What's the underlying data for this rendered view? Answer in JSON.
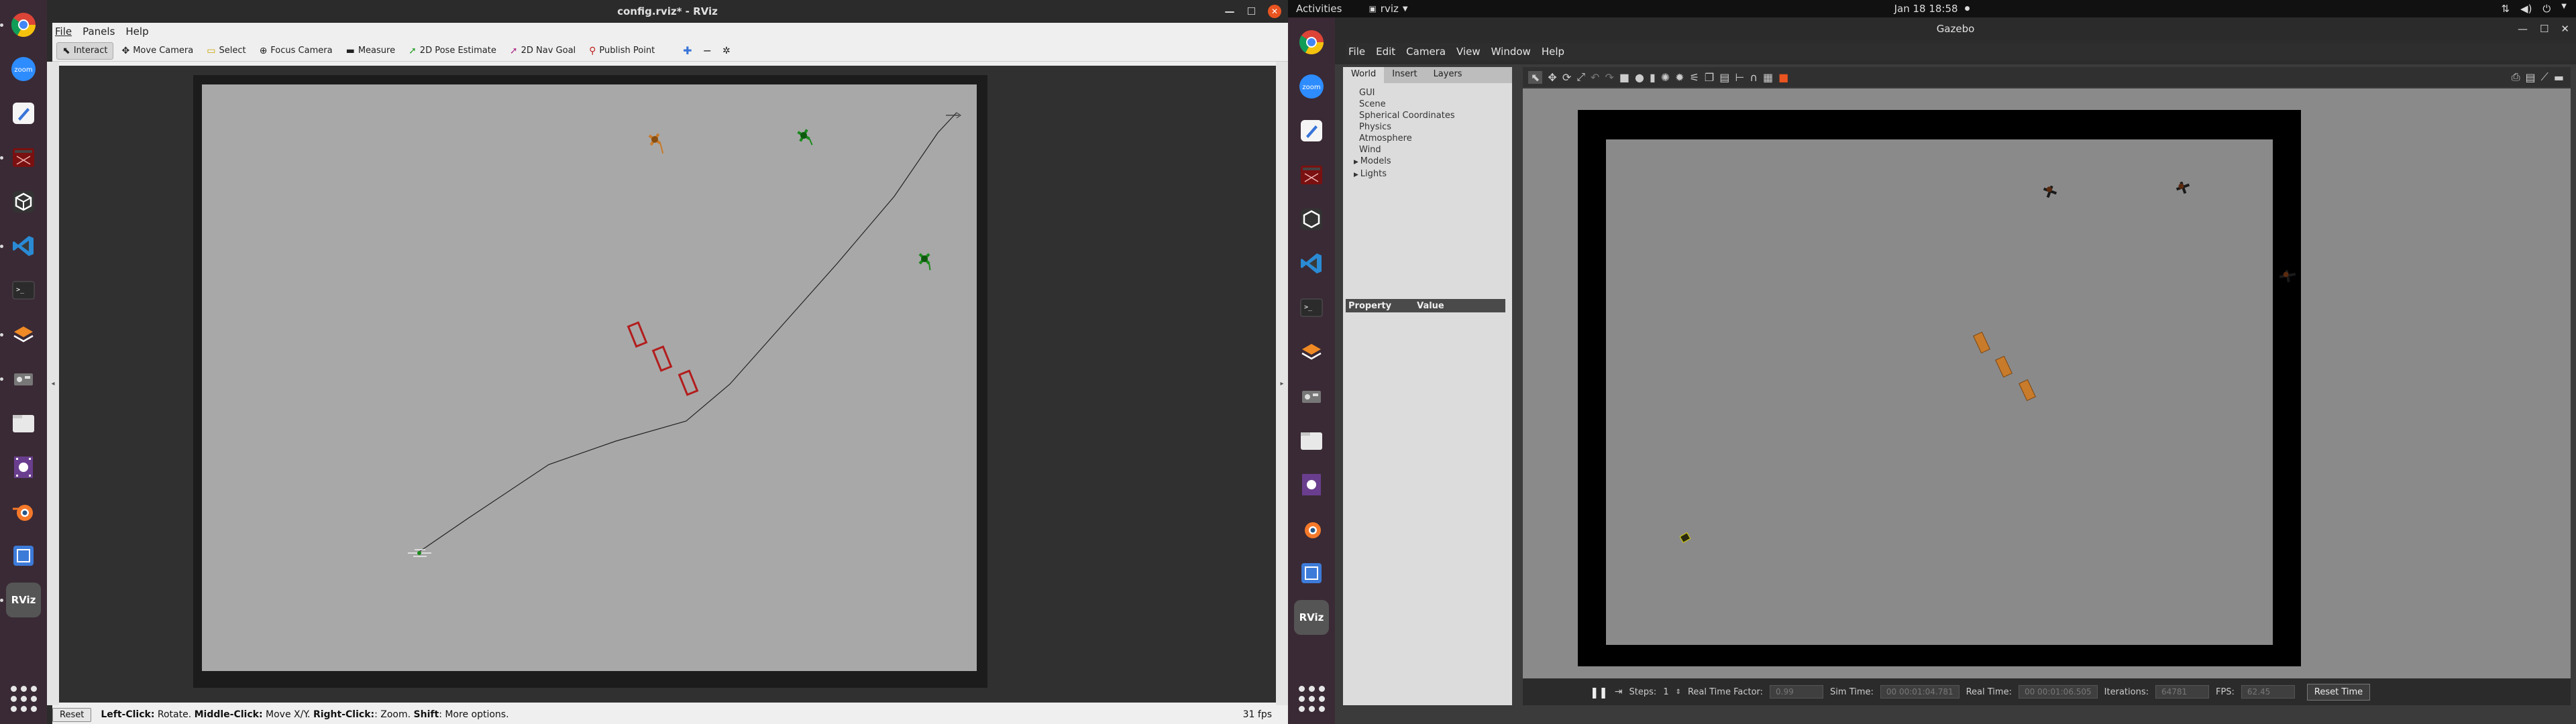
{
  "rviz": {
    "window_title": "config.rviz* - RViz",
    "menu": [
      "File",
      "Panels",
      "Help"
    ],
    "tools": [
      {
        "label": "Interact",
        "icon": "cursor-icon"
      },
      {
        "label": "Move Camera",
        "icon": "camera-icon"
      },
      {
        "label": "Select",
        "icon": "select-icon"
      },
      {
        "label": "Focus Camera",
        "icon": "focus-icon"
      },
      {
        "label": "Measure",
        "icon": "ruler-icon"
      },
      {
        "label": "2D Pose Estimate",
        "icon": "pose-arrow-icon"
      },
      {
        "label": "2D Nav Goal",
        "icon": "goal-arrow-icon"
      },
      {
        "label": "Publish Point",
        "icon": "pin-icon"
      }
    ],
    "status": {
      "reset_label": "Reset",
      "hint_parts": [
        {
          "bold": "Left-Click:",
          "text": " Rotate. "
        },
        {
          "bold": "Middle-Click:",
          "text": " Move X/Y. "
        },
        {
          "bold": "Right-Click:",
          "text": ": Zoom. "
        },
        {
          "bold": "Shift",
          "text": ": More options."
        }
      ],
      "fps": "31 fps"
    }
  },
  "topbar": {
    "activities": "Activities",
    "app_name": "rviz",
    "clock": "Jan 18  18:58"
  },
  "gazebo": {
    "window_title": "Gazebo",
    "menu": [
      "File",
      "Edit",
      "Camera",
      "View",
      "Window",
      "Help"
    ],
    "tabs": [
      "World",
      "Insert",
      "Layers"
    ],
    "tree": [
      "GUI",
      "Scene",
      "Spherical Coordinates",
      "Physics",
      "Atmosphere",
      "Wind",
      "Models",
      "Lights"
    ],
    "property_header": "Property",
    "value_header": "Value",
    "bottom": {
      "steps_label": "Steps:",
      "steps_value": "1",
      "rtf_label": "Real Time Factor:",
      "rtf_value": "0.99",
      "sim_time_label": "Sim Time:",
      "sim_time_value": "00 00:01:04.781",
      "real_time_label": "Real Time:",
      "real_time_value": "00 00:01:06.505",
      "iterations_label": "Iterations:",
      "iterations_value": "64781",
      "fps_label": "FPS:",
      "fps_value": "62.45",
      "reset_time_label": "Reset Time"
    }
  },
  "colors": {
    "ubuntu_orange": "#e95420",
    "rviz_map_gray": "#a8a8a8",
    "gazebo_ground": "#8c8c8c",
    "goal_green": "#1a8a1a",
    "obstacle_red": "#b21d1d",
    "obstacle_orange": "#c87b2a"
  }
}
